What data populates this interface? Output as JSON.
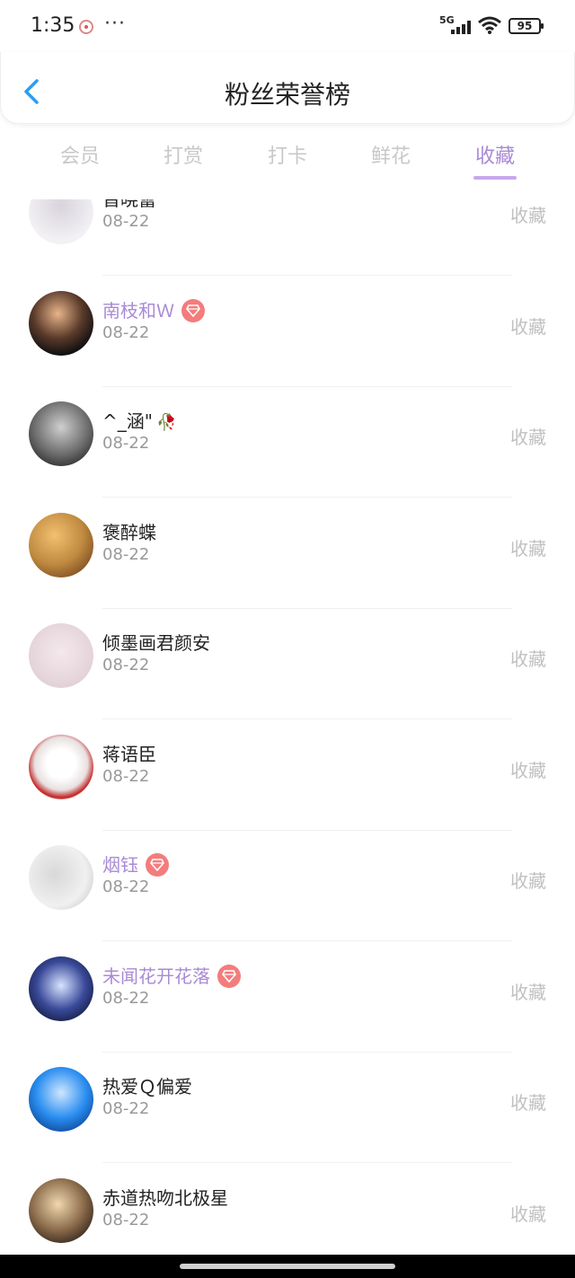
{
  "status_bar": {
    "time": "1:35",
    "more": "···",
    "network": "5G",
    "battery": "95"
  },
  "header": {
    "title": "粉丝荣誉榜"
  },
  "tabs": [
    {
      "label": "会员",
      "active": false
    },
    {
      "label": "打赏",
      "active": false
    },
    {
      "label": "打卡",
      "active": false
    },
    {
      "label": "鲜花",
      "active": false
    },
    {
      "label": "收藏",
      "active": true
    }
  ],
  "rows": [
    {
      "name": "晋晓蕾",
      "date": "08-22",
      "action": "收藏",
      "vip": false
    },
    {
      "name": "南枝和Ｗ",
      "date": "08-22",
      "action": "收藏",
      "vip": true
    },
    {
      "name": "^_涵\"",
      "date": "08-22",
      "action": "收藏",
      "vip": false,
      "flower": "🥀"
    },
    {
      "name": "褒醉蝶",
      "date": "08-22",
      "action": "收藏",
      "vip": false
    },
    {
      "name": "倾墨画君颜安",
      "date": "08-22",
      "action": "收藏",
      "vip": false
    },
    {
      "name": "蒋语臣",
      "date": "08-22",
      "action": "收藏",
      "vip": false
    },
    {
      "name": "烟钰",
      "date": "08-22",
      "action": "收藏",
      "vip": true
    },
    {
      "name": "未闻花开花落",
      "date": "08-22",
      "action": "收藏",
      "vip": true
    },
    {
      "name": "热爱Ｑ偏爱",
      "date": "08-22",
      "action": "收藏",
      "vip": false
    },
    {
      "name": "赤道热吻北极星",
      "date": "08-22",
      "action": "收藏",
      "vip": false
    }
  ],
  "colors": {
    "accent": "#a98ad6",
    "tab_inactive": "#c8c8c8",
    "action": "#c0c0c0",
    "gem": "#f47c7c"
  }
}
